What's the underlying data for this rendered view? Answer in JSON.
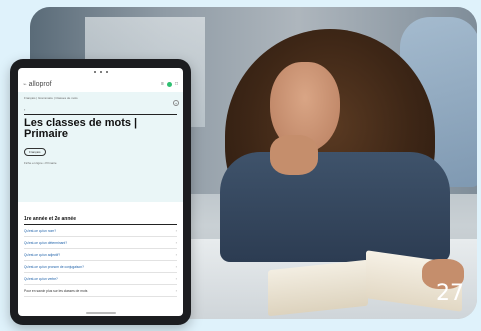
{
  "photo": {
    "page_number": "27"
  },
  "tablet": {
    "app": {
      "logo_text": "alloprof",
      "logo_mark": "⌁"
    },
    "breadcrumb": "Français | Grammaire | Classes de mots",
    "back_label": "‹",
    "page_title": "Les classes de mots | Primaire",
    "badge": "Français",
    "meta": "Fiche en ligne • Primaire",
    "section_title": "1re année et 2e année",
    "toc_items": [
      {
        "label": "Qu'est-ce qu'un nom?"
      },
      {
        "label": "Qu'est-ce qu'un déterminant?"
      },
      {
        "label": "Qu'est-ce qu'un adjectif?"
      },
      {
        "label": "Qu'est-ce qu'un pronom de conjugaison?"
      },
      {
        "label": "Qu'est-ce qu'un verbe?"
      },
      {
        "label": "Pour en savoir plus sur les classes de mots"
      }
    ]
  },
  "colors": {
    "background": "#dff2fb",
    "header_area": "#eaf6f7",
    "link": "#1b5fa8",
    "live_indicator": "#2fbf71"
  }
}
